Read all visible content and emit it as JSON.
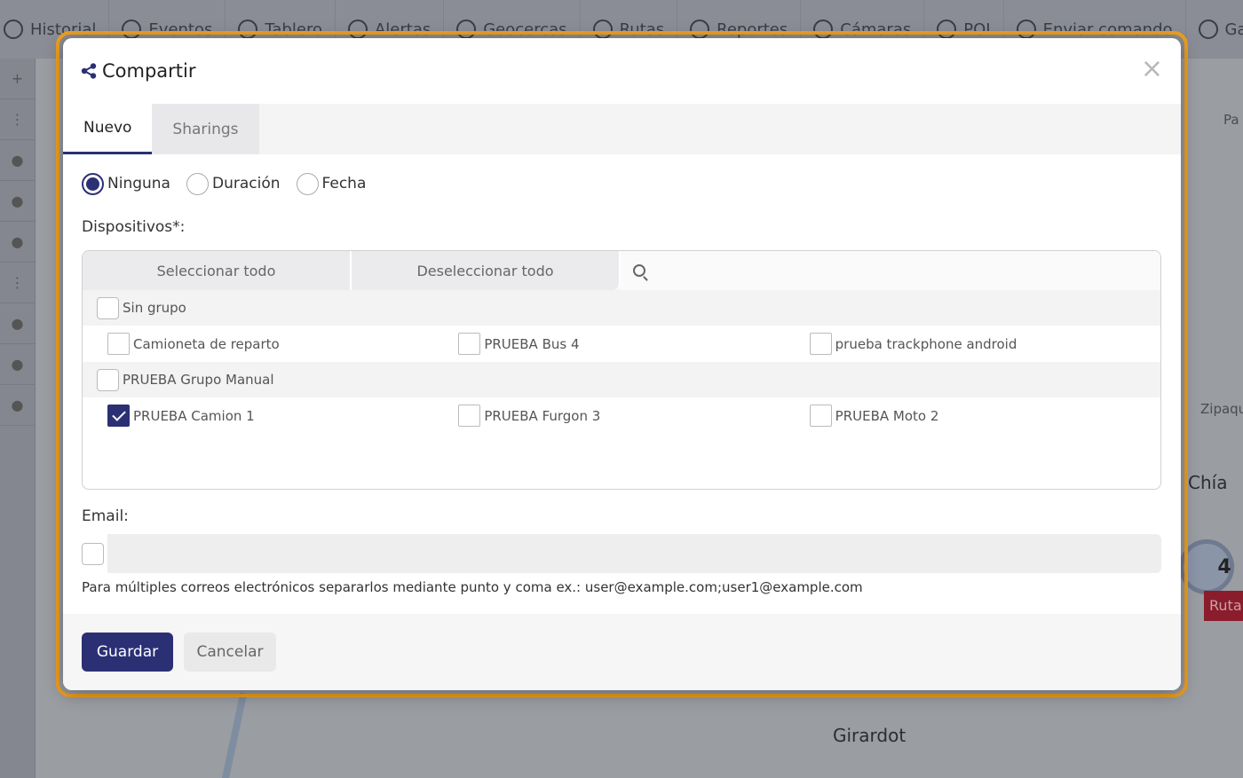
{
  "nav": {
    "items": [
      {
        "label": "Historial",
        "icon": "clock-icon"
      },
      {
        "label": "Eventos",
        "icon": "pulse-icon"
      },
      {
        "label": "Tablero",
        "icon": "gauge-icon"
      },
      {
        "label": "Alertas",
        "icon": "bell-icon"
      },
      {
        "label": "Geocercas",
        "icon": "geofence-icon"
      },
      {
        "label": "Rutas",
        "icon": "route-icon"
      },
      {
        "label": "Reportes",
        "icon": "chart-icon"
      },
      {
        "label": "Cámaras",
        "icon": "camera-icon"
      },
      {
        "label": "POI",
        "icon": "pin-icon"
      },
      {
        "label": "Enviar comando",
        "icon": "signal-icon"
      },
      {
        "label": "Gastos",
        "icon": "receipt-icon"
      }
    ]
  },
  "map": {
    "labels": {
      "chia": "Chía",
      "girardot": "Girardot",
      "zipaqu": "Zipaqu",
      "pa": "Pa"
    },
    "cluster_count": "4",
    "route_tag": "Ruta"
  },
  "modal": {
    "title": "Compartir",
    "title_icon": "share-icon",
    "close_label": "×",
    "tabs": [
      {
        "label": "Nuevo",
        "active": true
      },
      {
        "label": "Sharings",
        "active": false
      }
    ],
    "expiration_options": [
      {
        "label": "Ninguna",
        "selected": true
      },
      {
        "label": "Duración",
        "selected": false
      },
      {
        "label": "Fecha",
        "selected": false
      }
    ],
    "devices_label": "Dispositivos*:",
    "select_all": "Seleccionar todo",
    "deselect_all": "Deseleccionar todo",
    "search_placeholder": "",
    "groups": [
      {
        "name": "Sin grupo",
        "checked": false,
        "devices": [
          {
            "name": "Camioneta de reparto",
            "checked": false
          },
          {
            "name": "PRUEBA Bus 4",
            "checked": false
          },
          {
            "name": "prueba trackphone android",
            "checked": false
          }
        ]
      },
      {
        "name": "PRUEBA Grupo Manual",
        "checked": false,
        "devices": [
          {
            "name": "PRUEBA Camion 1",
            "checked": true
          },
          {
            "name": "PRUEBA Furgon 3",
            "checked": false
          },
          {
            "name": "PRUEBA Moto 2",
            "checked": false
          }
        ]
      }
    ],
    "email_label": "Email:",
    "email_value": "",
    "email_hint": "Para múltiples correos electrónicos separarlos mediante punto y coma ex.: user@example.com;user1@example.com",
    "save_label": "Guardar",
    "cancel_label": "Cancelar"
  },
  "colors": {
    "accent": "#2b3075",
    "focus_ring": "#f0a020"
  }
}
